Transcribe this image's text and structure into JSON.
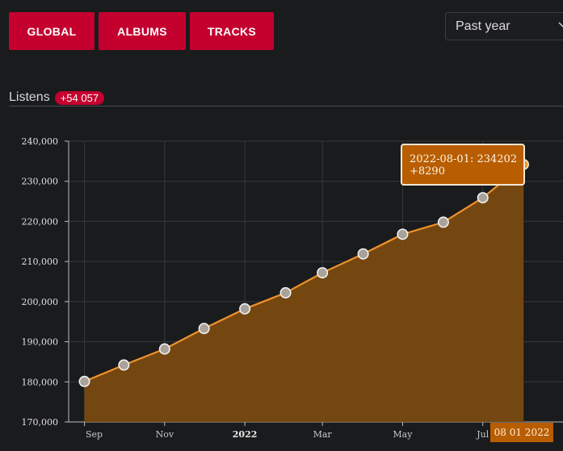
{
  "tabs": [
    {
      "label": "GLOBAL"
    },
    {
      "label": "ALBUMS"
    },
    {
      "label": "TRACKS"
    }
  ],
  "period_select": {
    "value": "Past year",
    "icon": "chevron-down-icon"
  },
  "listens": {
    "label": "Listens",
    "badge": "+54 057"
  },
  "colors": {
    "accent": "#c4002f",
    "series": "#f0922a",
    "area": "#7a4a10",
    "tooltip": "#b85d00"
  },
  "tooltip": {
    "line1": "2022-08-01: 234202",
    "line2": "+8290"
  },
  "x_hover_label": "08 01 2022",
  "chart_data": {
    "type": "area",
    "x": [
      "2021-09-01",
      "2021-10-01",
      "2021-11-01",
      "2021-12-01",
      "2022-01-01",
      "2022-02-01",
      "2022-03-01",
      "2022-04-01",
      "2022-05-01",
      "2022-06-01",
      "2022-07-01",
      "2022-08-01"
    ],
    "series": [
      {
        "values": [
          180100,
          184200,
          188200,
          193300,
          198200,
          202200,
          207200,
          211900,
          216800,
          219800,
          225900,
          234202
        ]
      }
    ],
    "ylim": [
      170000,
      240000
    ],
    "yticks": [
      170000,
      180000,
      190000,
      200000,
      210000,
      220000,
      230000,
      240000
    ],
    "ytick_labels": [
      "170,000",
      "180,000",
      "190,000",
      "200,000",
      "210,000",
      "220,000",
      "230,000",
      "240,000"
    ],
    "xtick_dates": [
      "2021-09-01",
      "2021-11-01",
      "2022-01-01",
      "2022-03-01",
      "2022-05-01",
      "2022-07-01"
    ],
    "xtick_labels": [
      "Sep",
      "Nov",
      "2022",
      "Mar",
      "May",
      "Jul"
    ],
    "grid": true
  }
}
